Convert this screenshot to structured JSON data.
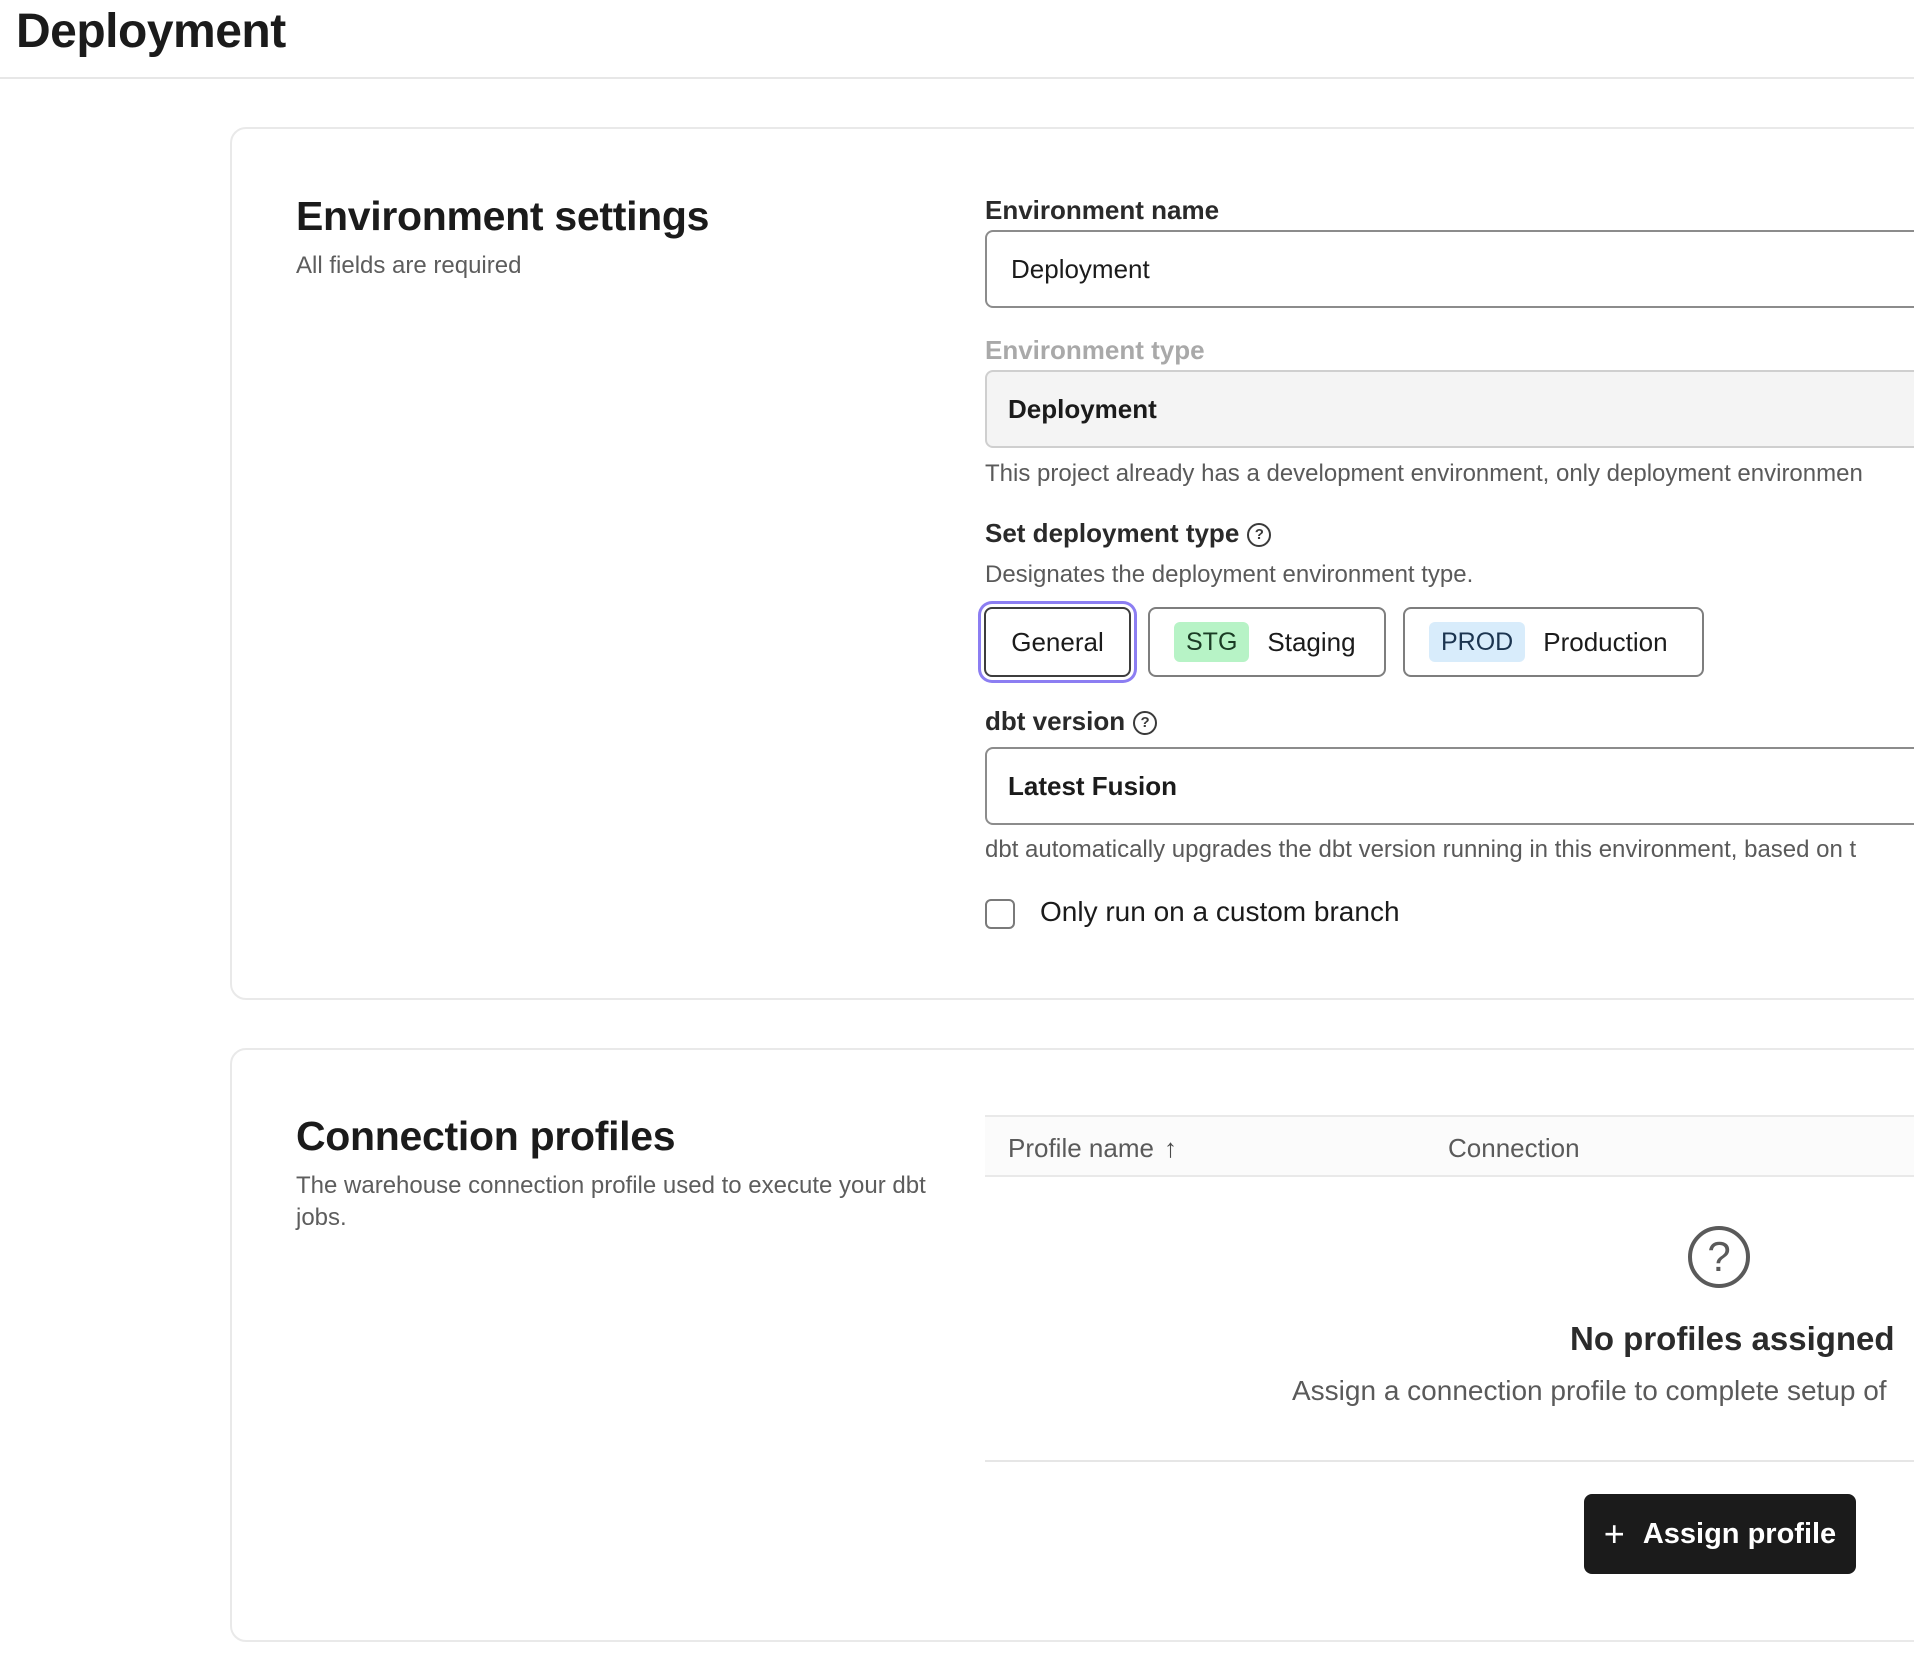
{
  "header": {
    "title": "Deployment"
  },
  "environment_settings": {
    "title": "Environment settings",
    "subtitle": "All fields are required",
    "env_name": {
      "label": "Environment name",
      "value": "Deployment"
    },
    "env_type": {
      "label": "Environment type",
      "value": "Deployment",
      "help": "This project already has a development environment, only deployment environmen"
    },
    "deployment_type": {
      "label": "Set deployment type",
      "help": "Designates the deployment environment type.",
      "options": [
        {
          "tag": "",
          "label": "General",
          "selected": true
        },
        {
          "tag": "STG",
          "label": "Staging",
          "selected": false
        },
        {
          "tag": "PROD",
          "label": "Production",
          "selected": false
        }
      ]
    },
    "dbt_version": {
      "label": "dbt version",
      "value": "Latest Fusion",
      "help": "dbt automatically upgrades the dbt version running in this environment, based on t"
    },
    "custom_branch": {
      "label": "Only run on a custom branch",
      "checked": false
    }
  },
  "connection_profiles": {
    "title": "Connection profiles",
    "subtitle": "The warehouse connection profile used to execute your dbt jobs.",
    "columns": [
      "Profile name",
      "Connection"
    ],
    "sort_indicator": "↑",
    "empty_icon": "?",
    "empty_title": "No profiles assigned",
    "empty_subtitle": "Assign a connection profile to complete setup of",
    "assign_button": "Assign profile",
    "assign_icon": "+"
  },
  "icons": {
    "help": "?"
  }
}
